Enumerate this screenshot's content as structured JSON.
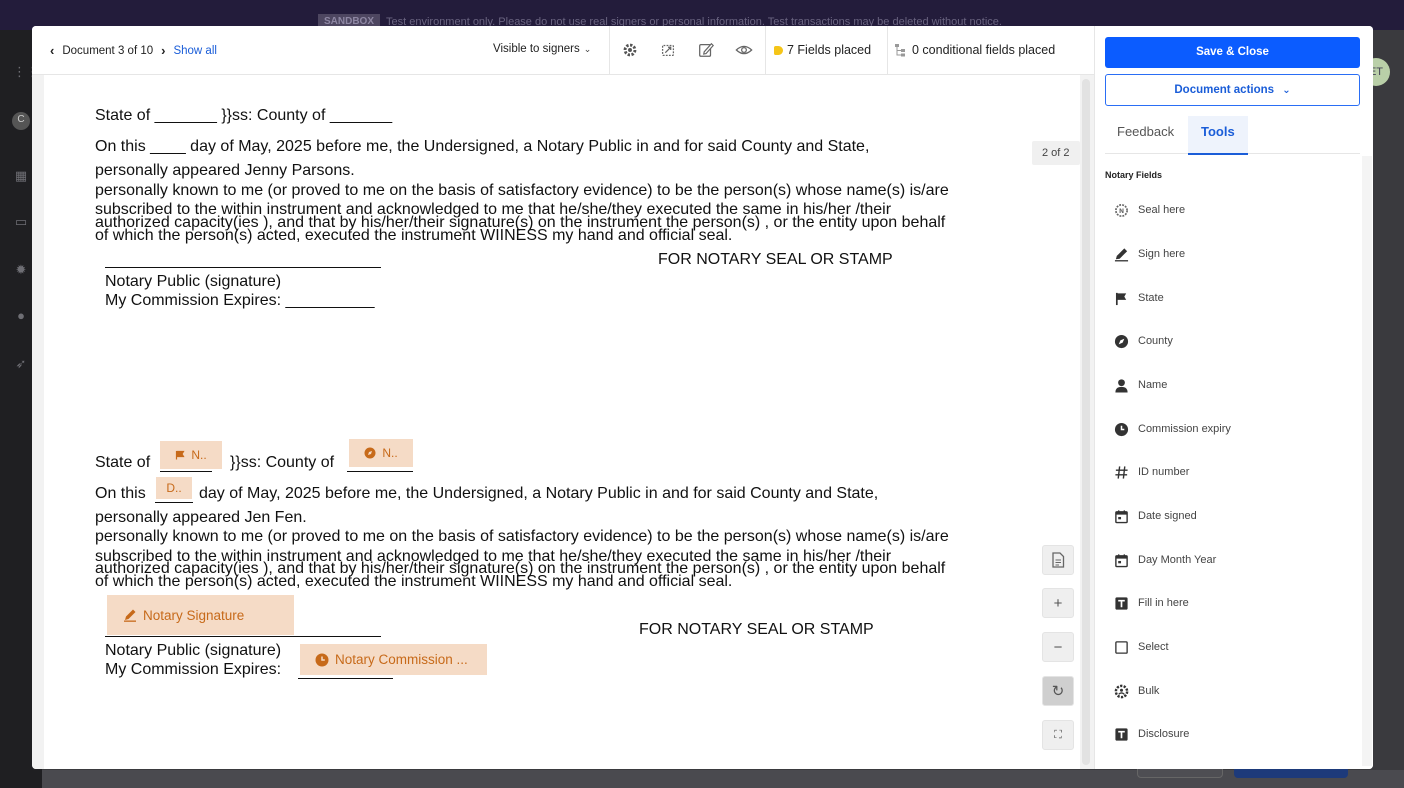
{
  "background": {
    "banner_tag": "SANDBOX",
    "banner_text": "Test environment only. Please do not use real signers or personal information. Test transactions may be deleted without notice.",
    "avatar": "ET"
  },
  "toolbar": {
    "doc_position": "Document 3 of 10",
    "show_all": "Show all",
    "visibility": "Visible to signers",
    "fields_placed": "7 Fields placed",
    "conditional_placed": "0 conditional fields placed"
  },
  "document": {
    "page_badge": "2 of 2",
    "block1": {
      "line_state": "State of _______ }}ss: County of _______",
      "line_onthis": "On this ____ day of May, 2025 before me, the Undersigned, a Notary Public in and for said County and State,",
      "line_appeared": "personally appeared Jenny Parsons.",
      "line_known": "personally known to me (or proved to me on the basis of satisfactory evidence) to be the person(s) whose name(s) is/are",
      "line_subscribed": "subscribed to the within instrument and acknowledged to me that he/she/they executed the same in his/her /their",
      "line_authorized": "authorized  capacity(ies ), and that by his/her/their signature(s) on the instrument the person(s) , or the entity upon behalf",
      "line_ofwhich": "of which the person(s) acted, executed the instrument WIINESS my hand and official seal.",
      "seal_label": "FOR NOTARY SEAL OR STAMP",
      "notary_sig": "Notary Public (signature)",
      "commission": "My Commission Expires: __________"
    },
    "block2": {
      "state_prefix": "State of",
      "state_mid": "}}ss: County of",
      "onthis_prefix": "On this",
      "onthis_rest": "day of May, 2025 before me, the Undersigned, a Notary Public in and for said County and State,",
      "line_appeared": "personally appeared Jen Fen.",
      "line_known": "personally known to me (or proved to me on the basis of satisfactory evidence) to be the person(s) whose name(s) is/are",
      "line_subscribed": "subscribed to the within instrument and acknowledged to me that he/she/they executed the same in his/her /their",
      "line_authorized": "authorized  capacity(ies ), and that by his/her/their signature(s) on the instrument the person(s) , or the entity upon behalf",
      "line_ofwhich": "of which the person(s) acted, executed the instrument WIINESS my hand and official seal.",
      "seal_label": "FOR NOTARY SEAL OR STAMP",
      "notary_sig": "Notary Public (signature)",
      "commission_prefix": "My Commission Expires:",
      "fields": {
        "state": "N..",
        "county": "N..",
        "day": "D..",
        "signature": "Notary Signature",
        "commission": "Notary Commission ..."
      }
    }
  },
  "panel": {
    "save_close": "Save & Close",
    "document_actions": "Document actions",
    "tabs": {
      "feedback": "Feedback",
      "tools": "Tools"
    },
    "notary_title": "Notary Fields",
    "tools": [
      {
        "label": "Seal here",
        "icon": "seal-icon"
      },
      {
        "label": "Sign here",
        "icon": "pen-icon"
      },
      {
        "label": "State",
        "icon": "flag-icon"
      },
      {
        "label": "County",
        "icon": "compass-icon"
      },
      {
        "label": "Name",
        "icon": "person-icon"
      },
      {
        "label": "Commission expiry",
        "icon": "clock-icon"
      },
      {
        "label": "ID number",
        "icon": "hash-icon"
      },
      {
        "label": "Date signed",
        "icon": "calendar-icon"
      },
      {
        "label": "Day Month Year",
        "icon": "calendar-icon"
      },
      {
        "label": "Fill in here",
        "icon": "text-box-icon"
      },
      {
        "label": "Select",
        "icon": "checkbox-icon"
      },
      {
        "label": "Bulk",
        "icon": "bulk-icon"
      },
      {
        "label": "Disclosure",
        "icon": "text-box-icon"
      }
    ]
  },
  "colors": {
    "accent": "#0b5cff",
    "field_bg": "#f5dbc6",
    "field_fg": "#c76a1a",
    "status_dot": "#f5c518"
  }
}
